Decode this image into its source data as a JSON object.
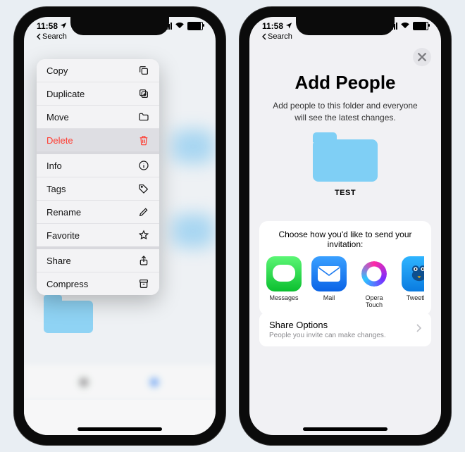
{
  "statusbar": {
    "time": "11:58",
    "back_label": "Search"
  },
  "left": {
    "menu": [
      {
        "label": "Copy",
        "icon": "copy",
        "danger": false,
        "selected": false,
        "group_start": false
      },
      {
        "label": "Duplicate",
        "icon": "duplicate",
        "danger": false,
        "selected": false,
        "group_start": false
      },
      {
        "label": "Move",
        "icon": "folder",
        "danger": false,
        "selected": false,
        "group_start": false
      },
      {
        "label": "Delete",
        "icon": "trash",
        "danger": true,
        "selected": true,
        "group_start": false
      },
      {
        "label": "Info",
        "icon": "info",
        "danger": false,
        "selected": false,
        "group_start": true
      },
      {
        "label": "Tags",
        "icon": "tag",
        "danger": false,
        "selected": false,
        "group_start": false
      },
      {
        "label": "Rename",
        "icon": "pencil",
        "danger": false,
        "selected": false,
        "group_start": false
      },
      {
        "label": "Favorite",
        "icon": "star",
        "danger": false,
        "selected": false,
        "group_start": false
      },
      {
        "label": "Share",
        "icon": "share",
        "danger": false,
        "selected": false,
        "group_start": true
      },
      {
        "label": "Compress",
        "icon": "archive",
        "danger": false,
        "selected": false,
        "group_start": false
      }
    ]
  },
  "right": {
    "title": "Add People",
    "subtitle": "Add people to this folder and everyone will see the latest changes.",
    "folder_name": "TEST",
    "chooser_title": "Choose how you'd like to send your invitation:",
    "apps": [
      {
        "name": "Messages",
        "icon": "messages"
      },
      {
        "name": "Mail",
        "icon": "mail"
      },
      {
        "name": "Opera Touch",
        "icon": "opera"
      },
      {
        "name": "Tweetbot",
        "icon": "tweetbot"
      },
      {
        "name": "",
        "icon": "slice"
      }
    ],
    "share_options": {
      "title": "Share Options",
      "subtitle": "People you invite can make changes."
    }
  }
}
